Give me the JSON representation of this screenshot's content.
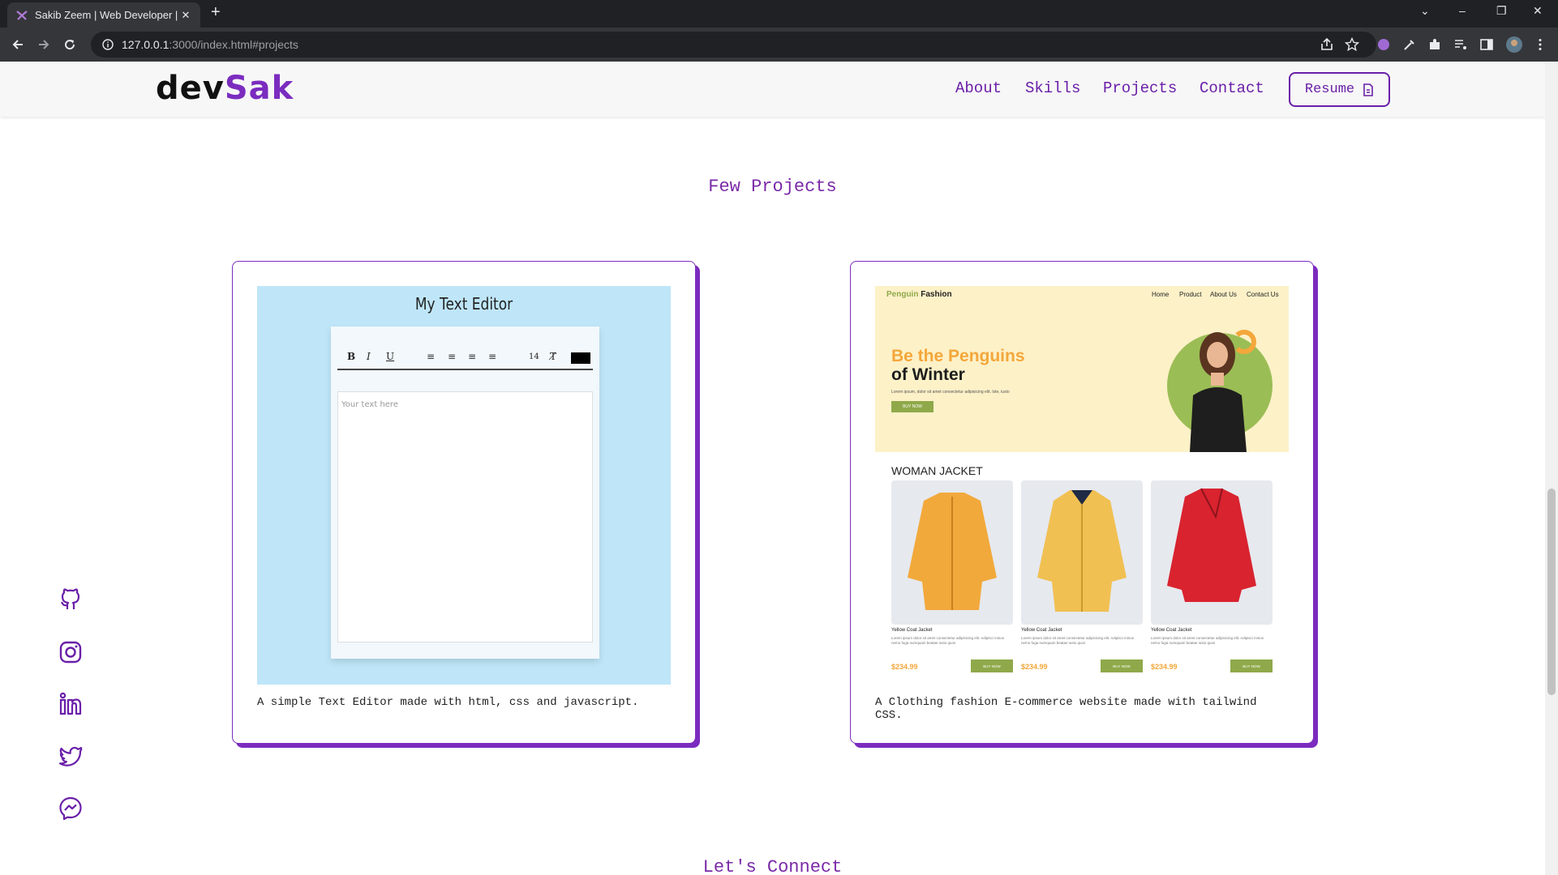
{
  "browser": {
    "tab_title": "Sakib Zeem | Web Developer | F",
    "tab_close": "✕",
    "new_tab": "+",
    "url_host": "127.0.0.1",
    "url_rest": ":3000/index.html#projects",
    "window_controls": [
      "⌄",
      "–",
      "❐",
      "✕"
    ]
  },
  "header": {
    "logo_part1": "dev",
    "logo_part2": "Sak",
    "nav": [
      "About",
      "Skills",
      "Projects",
      "Contact"
    ],
    "resume_label": "Resume"
  },
  "projects": {
    "title": "Few Projects",
    "cards": [
      {
        "description": "A simple Text Editor made with html, css and javascript.",
        "preview": {
          "title": "My Text Editor",
          "tools": [
            "B",
            "I",
            "U",
            "≡",
            "≡",
            "≡",
            "≡",
            "14",
            "T̸"
          ],
          "placeholder": "Your text here"
        }
      },
      {
        "description": "A Clothing fashion E-commerce website made with tailwind CSS.",
        "preview": {
          "brand_accent": "Penguin",
          "brand": "Fashion",
          "nav": [
            "Home",
            "Product",
            "About Us",
            "Contact Us"
          ],
          "hero_line1": "Be the Penguins",
          "hero_line2": "of Winter",
          "hero_text": "Lorem ipsum, dolor sit amet consectetur adipisicing elit. Iste, iusto",
          "hero_button": "BUY NOW",
          "section": "WOMAN JACKET",
          "products": [
            {
              "name": "Yellow Coat Jacket",
              "price": "$234.99",
              "button": "BUY NOW",
              "color": "#f2a93b"
            },
            {
              "name": "Yellow Coat Jacket",
              "price": "$234.99",
              "button": "BUY NOW",
              "color": "#f1c052"
            },
            {
              "name": "Yellow Coat Jacket",
              "price": "$234.99",
              "button": "BUY NOW",
              "color": "#d9232f"
            }
          ],
          "product_text": "Lorem ipsum dolor sit amet consectetur adipisicing elit. Adipisci minus nemo fuga numquam beatae iusto quos"
        }
      }
    ]
  },
  "connect_title": "Let's Connect",
  "social": [
    "github-icon",
    "instagram-icon",
    "linkedin-icon",
    "twitter-icon",
    "messenger-icon"
  ],
  "colors": {
    "accent": "#7b2cbf",
    "nav_text": "#6a1fa8",
    "browser_dark": "#202124",
    "browser_toolbar": "#35363a"
  }
}
